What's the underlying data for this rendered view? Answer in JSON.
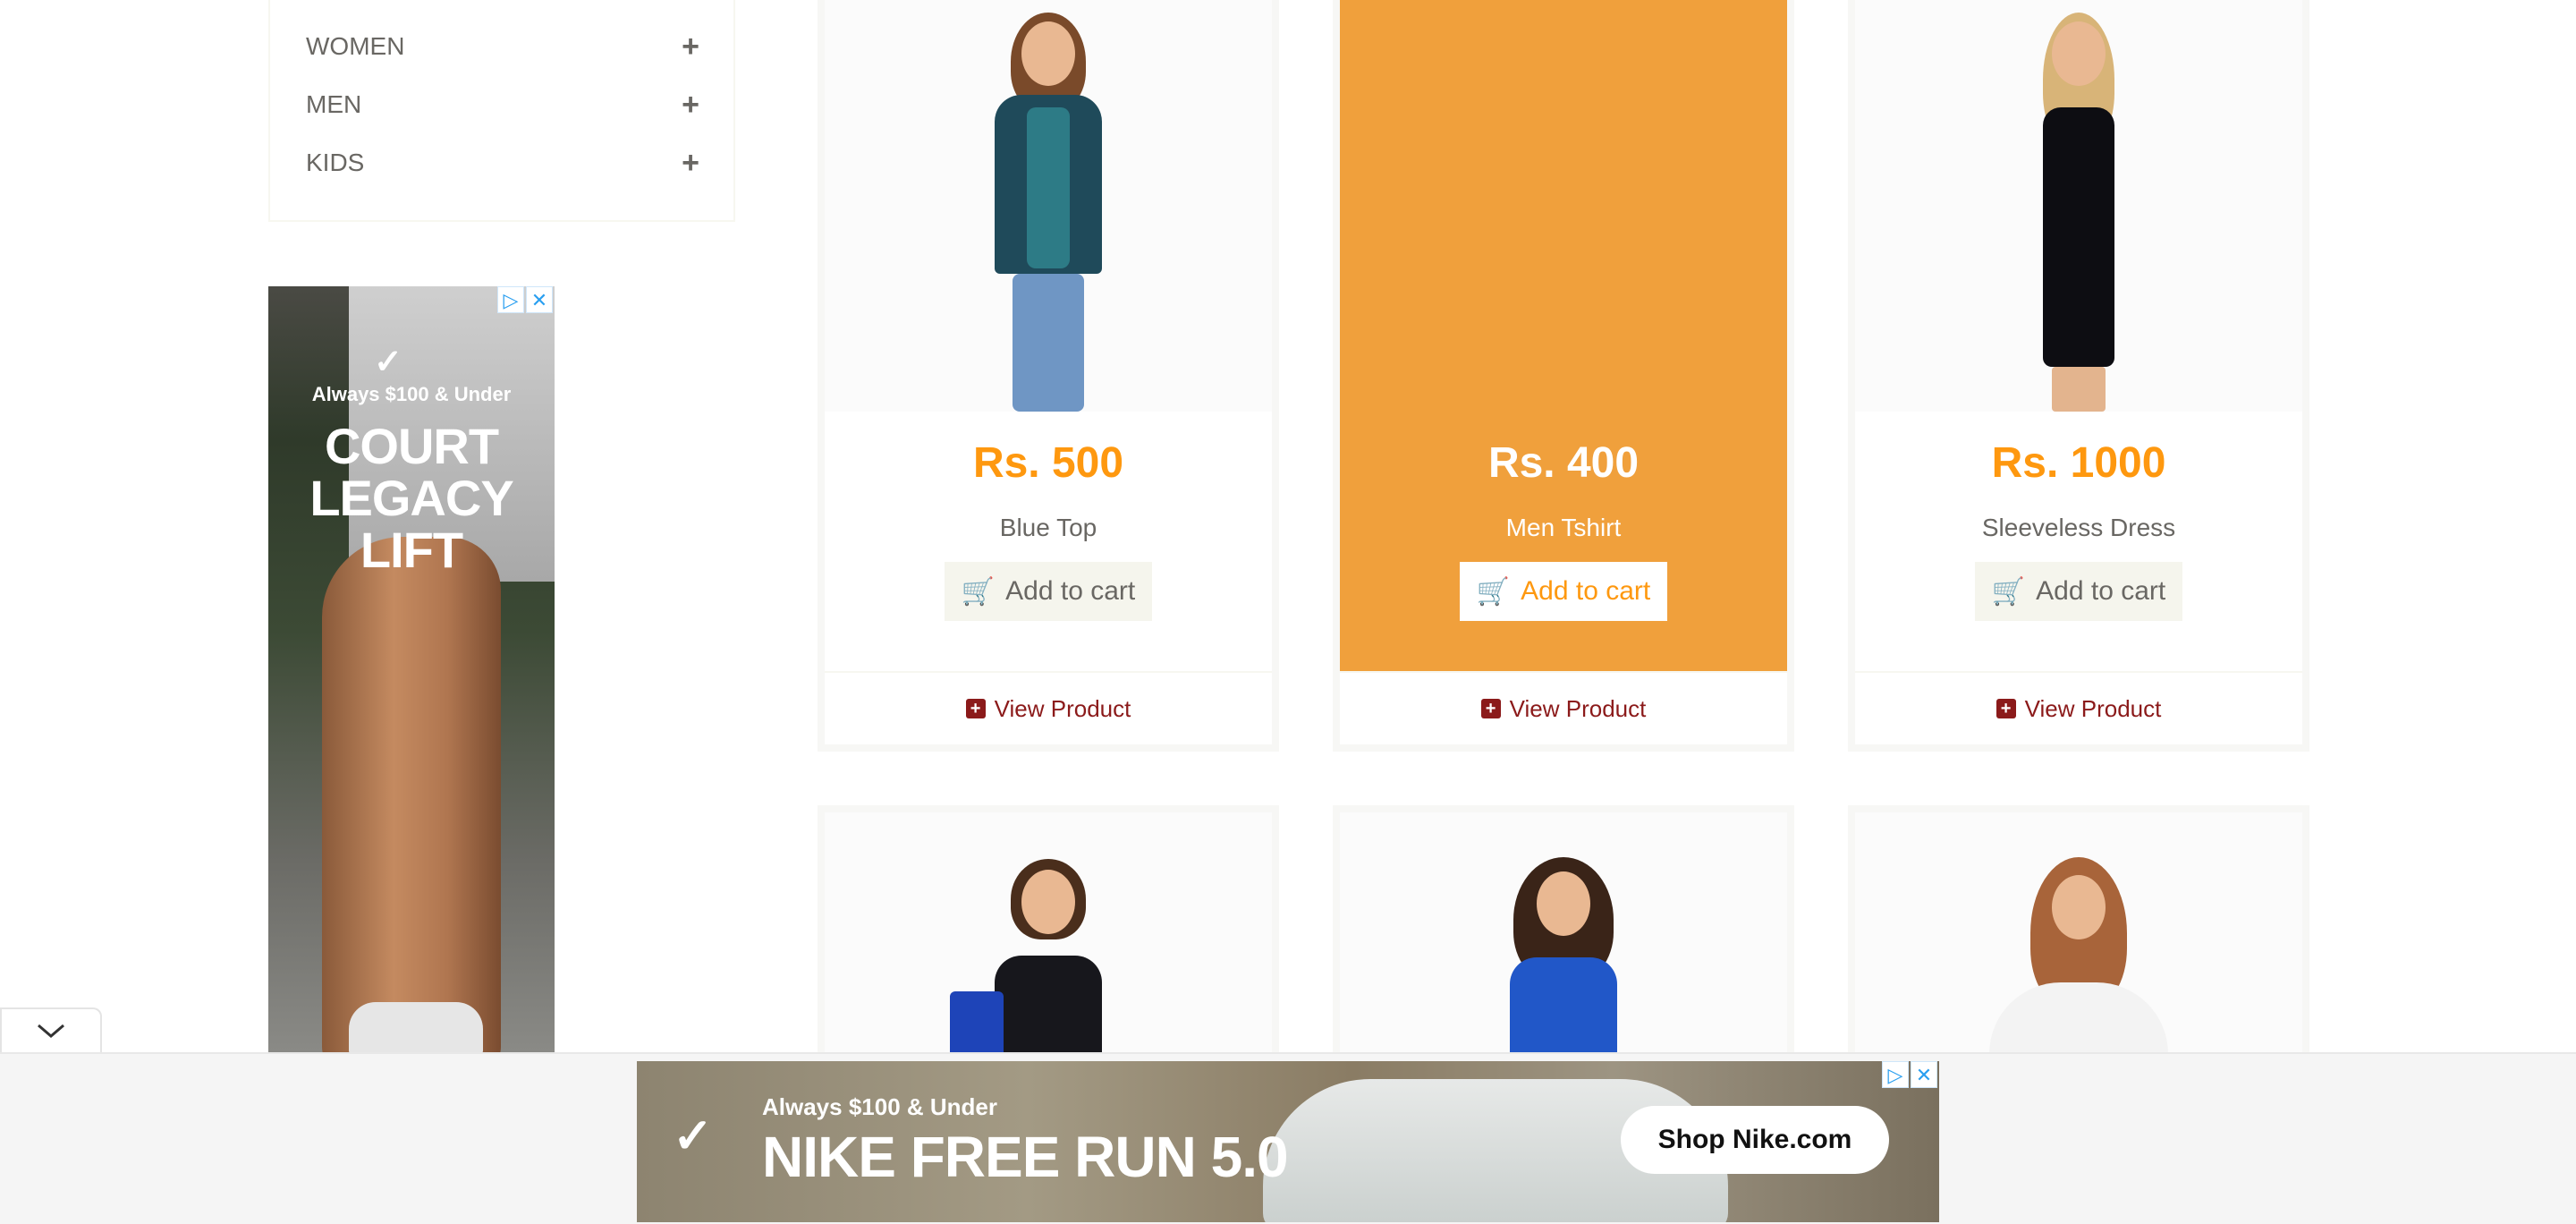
{
  "categories": [
    {
      "label": "WOMEN",
      "icon": "plus-icon"
    },
    {
      "label": "MEN",
      "icon": "plus-icon"
    },
    {
      "label": "KIDS",
      "icon": "plus-icon"
    }
  ],
  "side_ad": {
    "tagline": "Always $100 & Under",
    "headline_1": "COURT",
    "headline_2": "LEGACY",
    "headline_3": "LIFT"
  },
  "products": [
    {
      "price": "Rs. 500",
      "name": "Blue Top",
      "add_to_cart": "Add to cart",
      "view": "View Product"
    },
    {
      "price": "Rs. 400",
      "name": "Men Tshirt",
      "add_to_cart": "Add to cart",
      "view": "View Product"
    },
    {
      "price": "Rs. 1000",
      "name": "Sleeveless Dress",
      "add_to_cart": "Add to cart",
      "view": "View Product"
    }
  ],
  "bottom_ad": {
    "tagline": "Always $100 & Under",
    "headline": "NIKE FREE RUN 5.0",
    "cta": "Shop Nike.com"
  },
  "colors": {
    "price": "#fe980f",
    "hover_overlay": "#f0a03c",
    "view_link": "#8b1a1a"
  }
}
